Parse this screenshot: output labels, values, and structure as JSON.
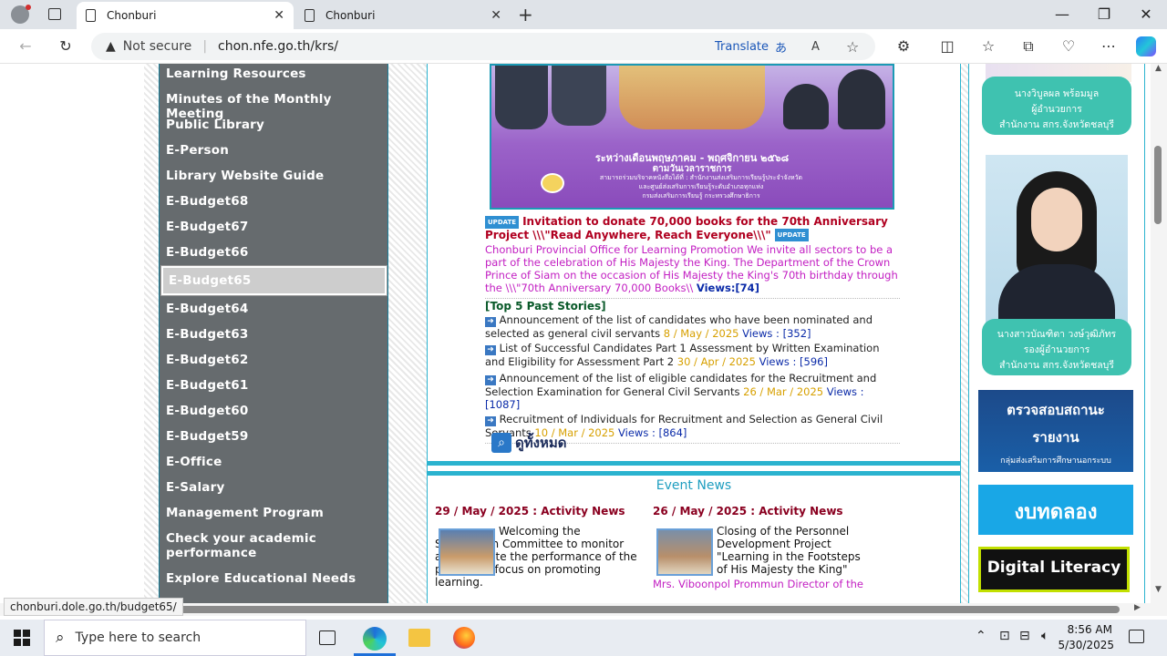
{
  "browser": {
    "tabs": [
      {
        "title": "Chonburi"
      },
      {
        "title": "Chonburi"
      }
    ],
    "security_label": "Not secure",
    "url": "chon.nfe.go.th/krs/",
    "translate_label": "Translate",
    "status_url": "chonburi.dole.go.th/budget65/"
  },
  "sidebar": {
    "items": [
      {
        "label": "Learning Resources"
      },
      {
        "label": "Minutes of the Monthly Meeting"
      },
      {
        "label": "Public Library"
      },
      {
        "label": "E-Person"
      },
      {
        "label": "Library Website Guide"
      },
      {
        "label": "E-Budget68"
      },
      {
        "label": "E-Budget67"
      },
      {
        "label": "E-Budget66"
      },
      {
        "label": "E-Budget65"
      },
      {
        "label": "E-Budget64"
      },
      {
        "label": "E-Budget63"
      },
      {
        "label": "E-Budget62"
      },
      {
        "label": "E-Budget61"
      },
      {
        "label": "E-Budget60"
      },
      {
        "label": "E-Budget59"
      },
      {
        "label": "E-Office"
      },
      {
        "label": "E-Salary"
      },
      {
        "label": "Management Program"
      },
      {
        "label": "Check your academic performance"
      },
      {
        "label": "Explore Educational Needs"
      }
    ]
  },
  "banner": {
    "line1": "ระหว่างเดือนพฤษภาคม - พฤศจิกายน ๒๕๖๘",
    "line2": "ตามวันเวลาราชการ",
    "line3": "สามารถร่วมบริจาคหนังสือได้ที่ : สำนักงานส่งเสริมการเรียนรู้ประจำจังหวัด",
    "line4": "และศูนย์ส่งเสริมการเรียนรู้ระดับอำเภอทุกแห่ง",
    "line5": "กรมส่งเสริมการเรียนรู้ กระทรวงศึกษาธิการ"
  },
  "featured": {
    "badge": "UPDATE",
    "title": "Invitation to donate 70,000 books for the 70th Anniversary Project \\\\\\\"Read Anywhere, Reach Everyone\\\\\\\"",
    "body": "Chonburi Provincial Office for Learning Promotion We invite all sectors to be a part of the celebration of His Majesty the King. The Department of the Crown Prince of Siam on the occasion of His Majesty the King's 70th birthday through the \\\\\\\"70th Anniversary 70,000 Books\\\\",
    "views": "Views:[74]"
  },
  "top5": {
    "heading": "[Top 5 Past Stories]",
    "items": [
      {
        "text": "Announcement of the list of candidates who have been nominated and selected as general civil servants",
        "date": "8 / May / 2025",
        "views": "Views : [352]"
      },
      {
        "text": "List of Successful Candidates Part 1 Assessment by Written Examination and Eligibility for Assessment Part 2",
        "date": "30 / Apr / 2025",
        "views": "Views : [596]"
      },
      {
        "text": "Announcement of the list of eligible candidates for the Recruitment and Selection Examination for General Civil Servants",
        "date": "26 / Mar / 2025",
        "views": "Views : [1087]"
      },
      {
        "text": "Recruitment of Individuals for Recruitment and Selection as General Civil Servants",
        "date": "10 / Mar / 2025",
        "views": "Views : [864]"
      }
    ],
    "view_all": "ดูทั้งหมด"
  },
  "events": {
    "heading": "Event News",
    "items": [
      {
        "date": "29 / May / 2025 : Activity News",
        "text": "Welcoming the Supervision Committee to monitor and evaluate the performance of the policy and focus on promoting learning."
      },
      {
        "date": "26 / May / 2025 : Activity News",
        "text": "Closing of the Personnel Development Project \"Learning in the Footsteps of His Majesty the King\"",
        "subtext": "Mrs. Viboonpol Prommun Director of the"
      }
    ]
  },
  "right_panel": {
    "person1": {
      "line1": "นางวิบูลผล พร้อมมูล",
      "line2": "ผู้อำนวยการ",
      "line3": "สำนักงาน สกร.จังหวัดชลบุรี"
    },
    "person2": {
      "line1": "นางสาวบัณฑิตา วงษ์วุฒิภัทร",
      "line2": "รองผู้อำนวยการ",
      "line3": "สำนักงาน สกร.จังหวัดชลบุรี"
    },
    "banner1": {
      "line1": "ตรวจสอบสถานะ",
      "line2": "รายงาน",
      "line3": "กลุ่มส่งเสริมการศึกษานอกระบบ"
    },
    "banner2": "งบทดลอง",
    "banner3": "Digital Literacy"
  },
  "taskbar": {
    "search_placeholder": "Type here to search",
    "time": "8:56 AM",
    "date": "5/30/2025"
  },
  "colors": {
    "menu_bg": "#666b6e",
    "accent_cyan": "#2bb3cf",
    "title_red": "#b00020",
    "body_magenta": "#c21ec2",
    "date_orange": "#d7a000",
    "views_blue": "#0a2aa8"
  }
}
